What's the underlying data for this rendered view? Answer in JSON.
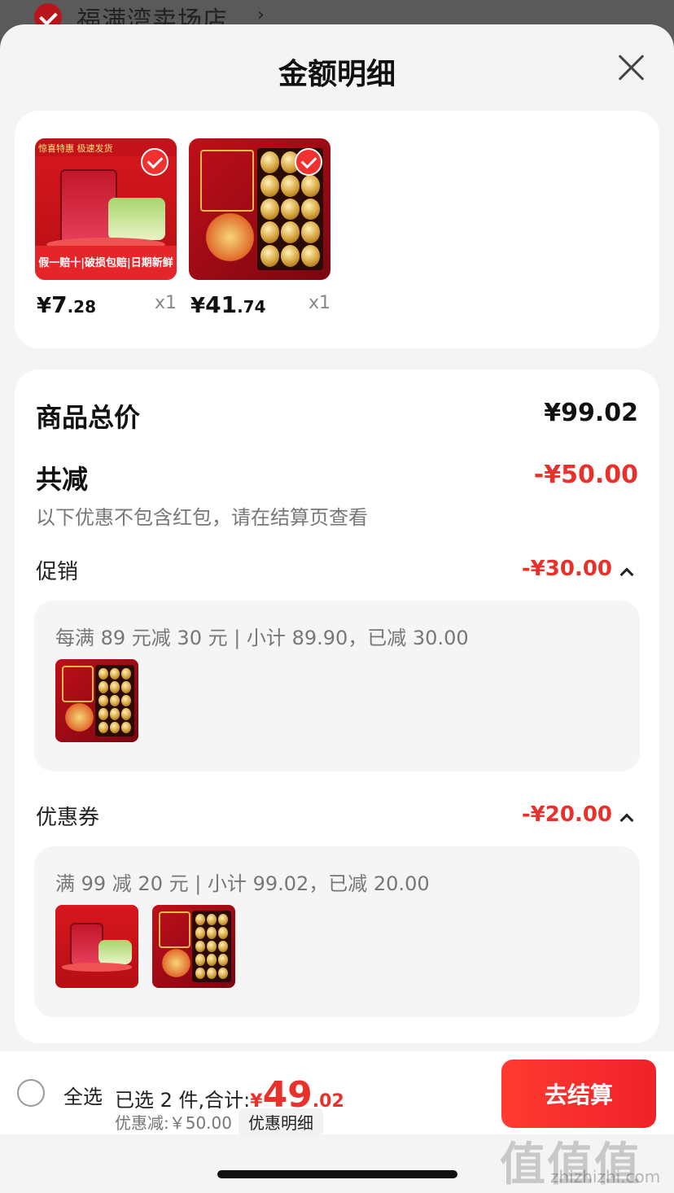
{
  "background": {
    "store_name": "福满湾卖场店",
    "store_chevron": "›"
  },
  "sheet": {
    "title": "金额明细"
  },
  "products": [
    {
      "price_yen": "¥",
      "price_int": "7",
      "price_dec": ".28",
      "qty": "x1",
      "banner_text": "惊喜特惠 极速发货",
      "bottom_text": "假一赔十|破损包赔|日期新鲜"
    },
    {
      "price_yen": "¥",
      "price_int": "41",
      "price_dec": ".74",
      "qty": "x1"
    }
  ],
  "summary": {
    "total_label": "商品总价",
    "total_value": "¥99.02",
    "reduce_label": "共减",
    "reduce_value": "-¥50.00",
    "reduce_hint": "以下优惠不包含红包，请在结算页查看",
    "promo": {
      "label": "促销",
      "value": "-¥30.00",
      "desc": "每满 89 元减 30 元 | 小计 89.90，已减 30.00"
    },
    "coupon": {
      "label": "优惠券",
      "value": "-¥20.00",
      "desc": "满 99 减 20 元 | 小计 99.02，已减 20.00"
    }
  },
  "bottom_bar": {
    "select_all": "全选",
    "selected_text": "已选 2 件,合计:",
    "total_yen": "¥",
    "total_int": "49",
    "total_dec": ".02",
    "discount_text": "优惠减:￥50.00",
    "discount_detail_button": "优惠明细",
    "checkout_button": "去结算"
  },
  "watermark": {
    "logo": "值值值",
    "url": "zhizhizhi.com"
  },
  "colors": {
    "accent_red": "#e8312b",
    "checkout_gradient": "#ff3b30"
  }
}
